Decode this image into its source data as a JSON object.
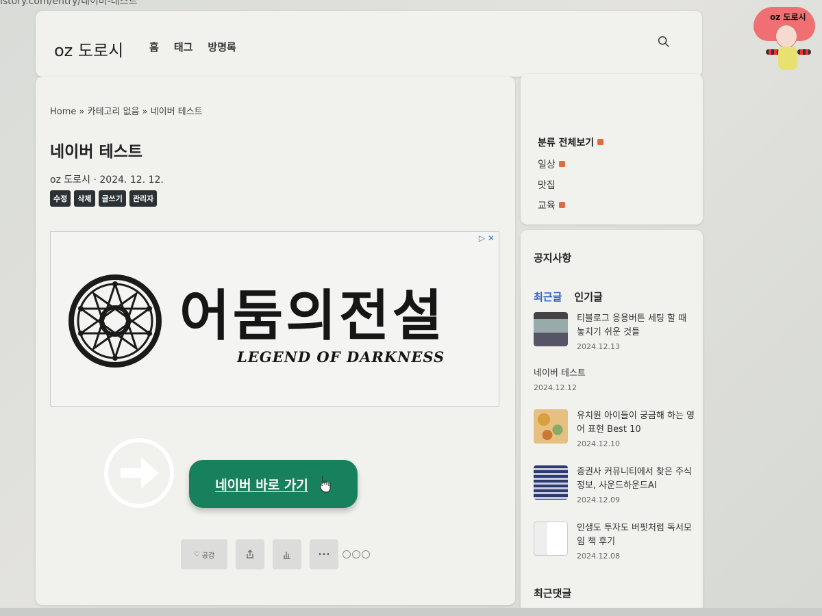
{
  "browser": {
    "url_fragment": "istory.com/entry/네이버-테스트"
  },
  "header": {
    "logo": "oz 도로시",
    "nav": [
      "홈",
      "태그",
      "방명록"
    ],
    "search_icon": "search-icon"
  },
  "mascot": {
    "label": "oz 도로시"
  },
  "post": {
    "breadcrumb": "Home » 카테고리 없음 » 네이버 테스트",
    "title": "네이버 테스트",
    "author": "oz 도로시",
    "date": "2024. 12. 12.",
    "admin_tools": [
      "수정",
      "삭제",
      "글쓰기",
      "관리자"
    ],
    "ad": {
      "title": "어둠의전설",
      "subtitle": "LEGEND OF DARKNESS",
      "badge": "▷ ✕"
    },
    "cta_button": "네이버 바로 가기",
    "reactions": {
      "like": "공감"
    }
  },
  "sidebar": {
    "categories": {
      "all": "분류 전체보기",
      "items": [
        {
          "label": "일상",
          "new": true
        },
        {
          "label": "맛집",
          "new": false
        },
        {
          "label": "교육",
          "new": true
        }
      ]
    },
    "notice_title": "공지사항",
    "tabs": [
      "최근글",
      "인기글"
    ],
    "posts": [
      {
        "title": "티블로그 응용버튼 세팅 할 때 놓치기 쉬운 것들",
        "date": "2024.12.13",
        "thumb": "screenshot"
      },
      {
        "title": "네이버 테스트",
        "date": "2024.12.12",
        "thumb": ""
      },
      {
        "title": "유치원 아이들이 궁금해 하는 영어 표현 Best 10",
        "date": "2024.12.10",
        "thumb": "snacks"
      },
      {
        "title": "증권사 커뮤니티에서 찾은 주식정보, 사운드하운드AI",
        "date": "2024.12.09",
        "thumb": "stock-board"
      },
      {
        "title": "인생도 투자도 버핏처럼 독서모임 책 후기",
        "date": "2024.12.08",
        "thumb": "book"
      }
    ],
    "recent_comments_title": "최근댓글"
  },
  "colors": {
    "accent": "#17805c",
    "tab_active": "#2e62c6",
    "new_badge": "#e06a3b"
  }
}
